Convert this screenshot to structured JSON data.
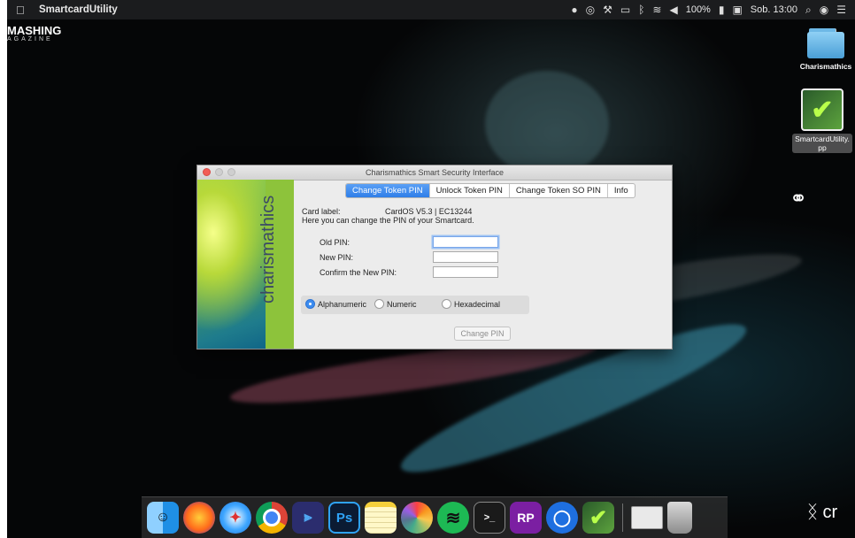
{
  "menubar": {
    "app_name": "SmartcardUtility",
    "battery": "100%",
    "clock": "Sob. 13:00"
  },
  "desktop": {
    "brand_title": "MASHING",
    "brand_subtitle": "AGAZINE",
    "items": [
      {
        "label": "Charismathics"
      },
      {
        "label": "SmartcardUtility.\npp"
      }
    ]
  },
  "window": {
    "title": "Charismathics Smart Security Interface",
    "sidebar_brand": "charismathics",
    "tabs": [
      {
        "label": "Change Token PIN",
        "active": true
      },
      {
        "label": "Unlock Token PIN"
      },
      {
        "label": "Change Token SO PIN"
      },
      {
        "label": "Info"
      }
    ],
    "card_label_name": "Card label:",
    "card_label_value": "CardOS V5.3 | EC13244",
    "description": "Here you can change the PIN of your Smartcard.",
    "fields": [
      {
        "label": "Old PIN:",
        "value": ""
      },
      {
        "label": "New PIN:",
        "value": ""
      },
      {
        "label": "Confirm the New PIN:",
        "value": ""
      }
    ],
    "encoding": {
      "options": [
        "Alphanumeric",
        "Numeric",
        "Hexadecimal"
      ],
      "selected": "Alphanumeric"
    },
    "submit_label": "Change PIN"
  },
  "dock": {
    "apps": [
      "finder",
      "firefox",
      "safari",
      "chrome",
      "vscode",
      "photoshop",
      "notes",
      "photos",
      "spotify",
      "terminal",
      "rp",
      "blue-app",
      "smartcard",
      "window-preview",
      "trash"
    ]
  },
  "corner_text": "ᛝ cr"
}
